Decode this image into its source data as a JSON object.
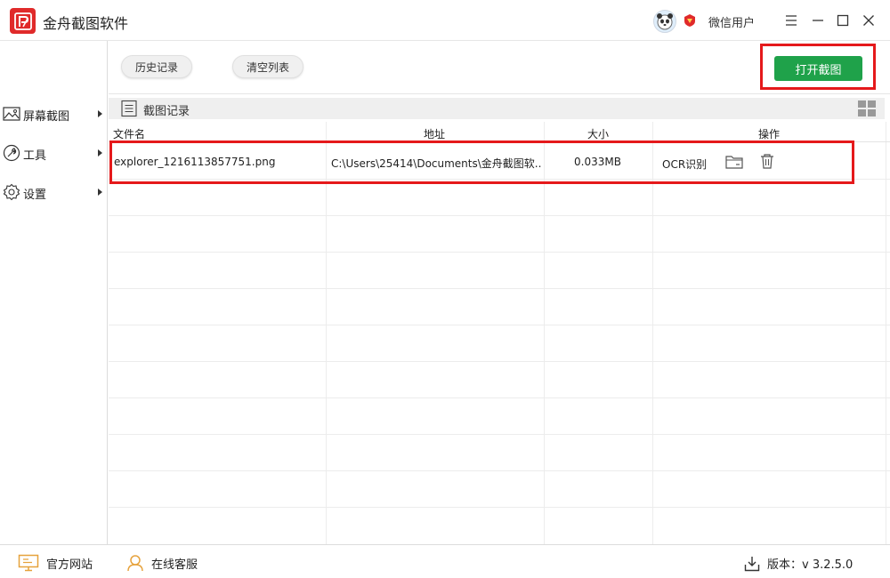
{
  "app": {
    "title": "金舟截图软件",
    "username": "微信用户",
    "colors": {
      "accent_red": "#e02a2a",
      "primary_green": "#1fa24a",
      "highlight_red": "#e5191b"
    }
  },
  "sidebar": {
    "items": [
      {
        "label": "屏幕截图",
        "icon": "image-icon"
      },
      {
        "label": "工具",
        "icon": "wrench-icon"
      },
      {
        "label": "设置",
        "icon": "gear-icon"
      }
    ]
  },
  "toolbar": {
    "history_label": "历史记录",
    "clear_label": "清空列表",
    "open_label": "打开截图"
  },
  "section": {
    "title": "截图记录"
  },
  "table": {
    "headers": {
      "name": "文件名",
      "path": "地址",
      "size": "大小",
      "ops": "操作"
    },
    "rows": [
      {
        "name": "explorer_1216113857751.png",
        "path": "C:\\Users\\25414\\Documents\\金舟截图软...",
        "size": "0.033MB",
        "ocr": "OCR识别"
      }
    ]
  },
  "footer": {
    "website": "官方网站",
    "service": "在线客服",
    "version": "版本：v 3.2.5.0"
  }
}
